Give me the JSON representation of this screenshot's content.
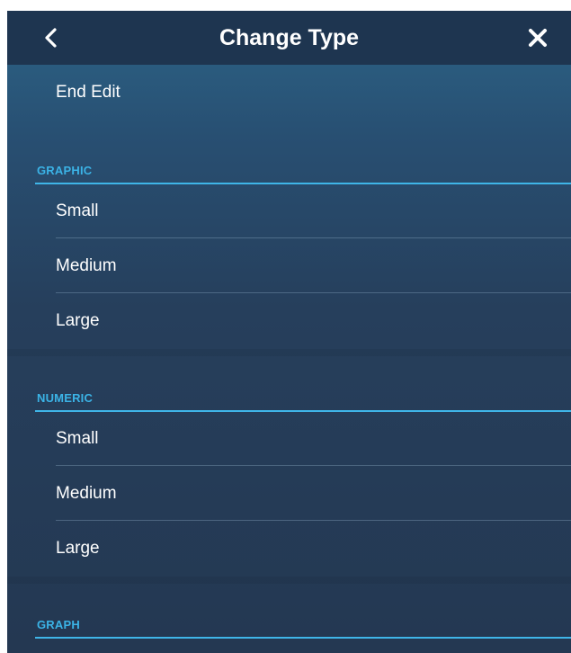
{
  "header": {
    "title": "Change Type",
    "back_icon": "chevron-left-icon",
    "close_icon": "close-icon"
  },
  "end_edit": {
    "label": "End Edit"
  },
  "sections": [
    {
      "title": "GRAPHIC",
      "items": [
        "Small",
        "Medium",
        "Large"
      ]
    },
    {
      "title": "NUMERIC",
      "items": [
        "Small",
        "Medium",
        "Large"
      ]
    },
    {
      "title": "GRAPH",
      "items": []
    }
  ],
  "colors": {
    "header_bg": "#1e3550",
    "accent": "#3fb5e8",
    "section_text": "#3bb3e6",
    "item_text": "#ffffff"
  }
}
